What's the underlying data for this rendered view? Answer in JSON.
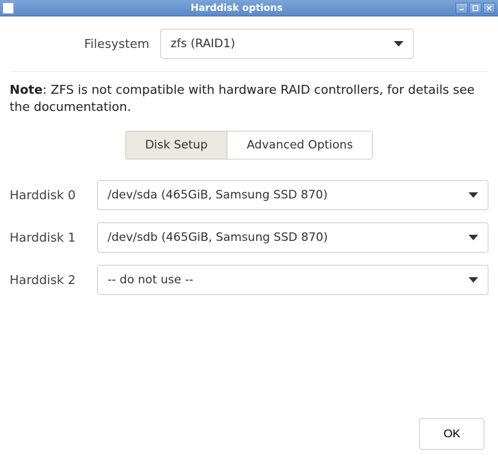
{
  "window": {
    "title": "Harddisk options"
  },
  "filesystem": {
    "label": "Filesystem",
    "selected": "zfs (RAID1)"
  },
  "note": {
    "bold": "Note",
    "text": ": ZFS is not compatible with hardware RAID controllers, for details see the documentation."
  },
  "tabs": {
    "disk_setup": "Disk Setup",
    "advanced": "Advanced Options",
    "active": "disk_setup"
  },
  "disks": [
    {
      "label": "Harddisk 0",
      "value": "/dev/sda (465GiB, Samsung SSD 870)"
    },
    {
      "label": "Harddisk 1",
      "value": "/dev/sdb (465GiB, Samsung SSD 870)"
    },
    {
      "label": "Harddisk 2",
      "value": "-- do not use --"
    }
  ],
  "buttons": {
    "ok": "OK"
  }
}
